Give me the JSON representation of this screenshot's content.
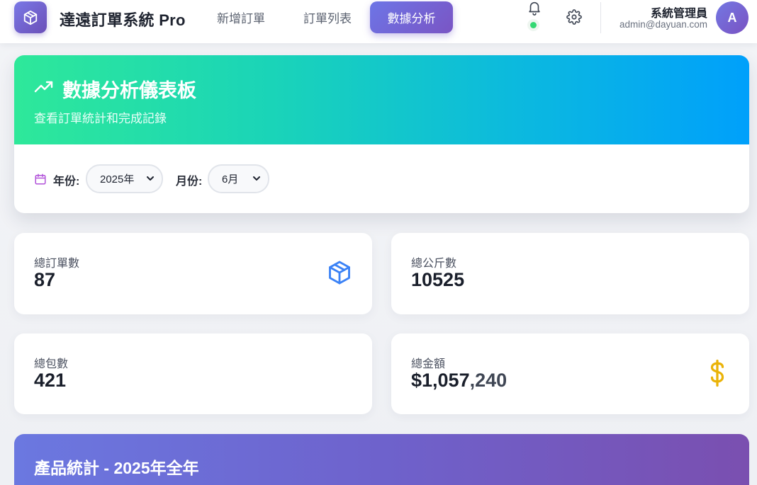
{
  "header": {
    "app_title": "達遠訂單系統 Pro",
    "nav": [
      {
        "label": "新增訂單",
        "active": false
      },
      {
        "label": "訂單列表",
        "active": false
      },
      {
        "label": "數據分析",
        "active": true
      }
    ],
    "icons": {
      "logo": "cube-icon",
      "notifications": "bell-icon",
      "settings": "gear-icon"
    },
    "user": {
      "name": "系統管理員",
      "email": "admin@dayuan.com",
      "avatar_initial": "A"
    },
    "colors": {
      "accent": "#6d75e6",
      "online": "#34d873"
    }
  },
  "dashboard": {
    "title": "數據分析儀表板",
    "subtitle": "查看訂單統計和完成記錄",
    "icon": "trending-up-icon",
    "filters": {
      "year_label": "年份:",
      "year_value": "2025年",
      "month_label": "月份:",
      "month_value": "6月"
    }
  },
  "stats": {
    "total_orders": {
      "label": "總訂單數",
      "value": "87",
      "icon": "package-icon",
      "icon_color": "#3b82f6"
    },
    "total_kg": {
      "label": "總公斤數",
      "value": "10525"
    },
    "total_packages": {
      "label": "總包數",
      "value": "421"
    },
    "total_amount": {
      "label": "總金額",
      "value_main": "$1,057",
      "value_tail": ",240",
      "icon": "dollar-icon",
      "icon_color": "#eab308"
    }
  },
  "product_stats": {
    "title": "產品統計 - 2025年全年"
  }
}
